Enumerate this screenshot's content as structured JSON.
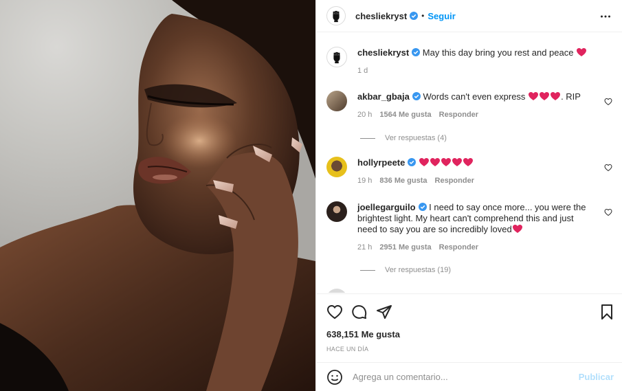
{
  "post": {
    "author": "chesliekryst",
    "follow_label": "Seguir",
    "separator": "•",
    "more_icon": "more-horizontal-icon"
  },
  "caption": {
    "user": "chesliekryst",
    "text": "May this day bring you rest and peace",
    "time": "1 d"
  },
  "comments": [
    {
      "user": "akbar_gbaja",
      "text": "Words can't even express",
      "suffix": ". RIP",
      "hearts": 3,
      "time": "20 h",
      "likes": "1564 Me gusta",
      "reply": "Responder",
      "replies_label": "Ver respuestas (4)"
    },
    {
      "user": "hollyrpeete",
      "text": "",
      "hearts": 5,
      "time": "19 h",
      "likes": "836 Me gusta",
      "reply": "Responder"
    },
    {
      "user": "joellegarguilo",
      "text": "I need to say once more... you were the brightest light. My heart can't comprehend this and just need to say you are so incredibly loved",
      "hearts": 1,
      "time": "21 h",
      "likes": "2951 Me gusta",
      "reply": "Responder",
      "replies_label": "Ver respuestas (19)"
    }
  ],
  "actions": {
    "like_icon": "heart-icon",
    "comment_icon": "comment-icon",
    "share_icon": "paper-plane-icon",
    "save_icon": "bookmark-icon",
    "likes_count": "638,151 Me gusta",
    "posted": "HACE UN DÍA"
  },
  "composer": {
    "emoji_icon": "emoji-icon",
    "placeholder": "Agrega un comentario...",
    "publish_label": "Publicar"
  },
  "colors": {
    "accent": "#0095f6",
    "verified": "#3897f0",
    "heart_emoji": "#e0245e",
    "muted": "#8e8e8e"
  }
}
